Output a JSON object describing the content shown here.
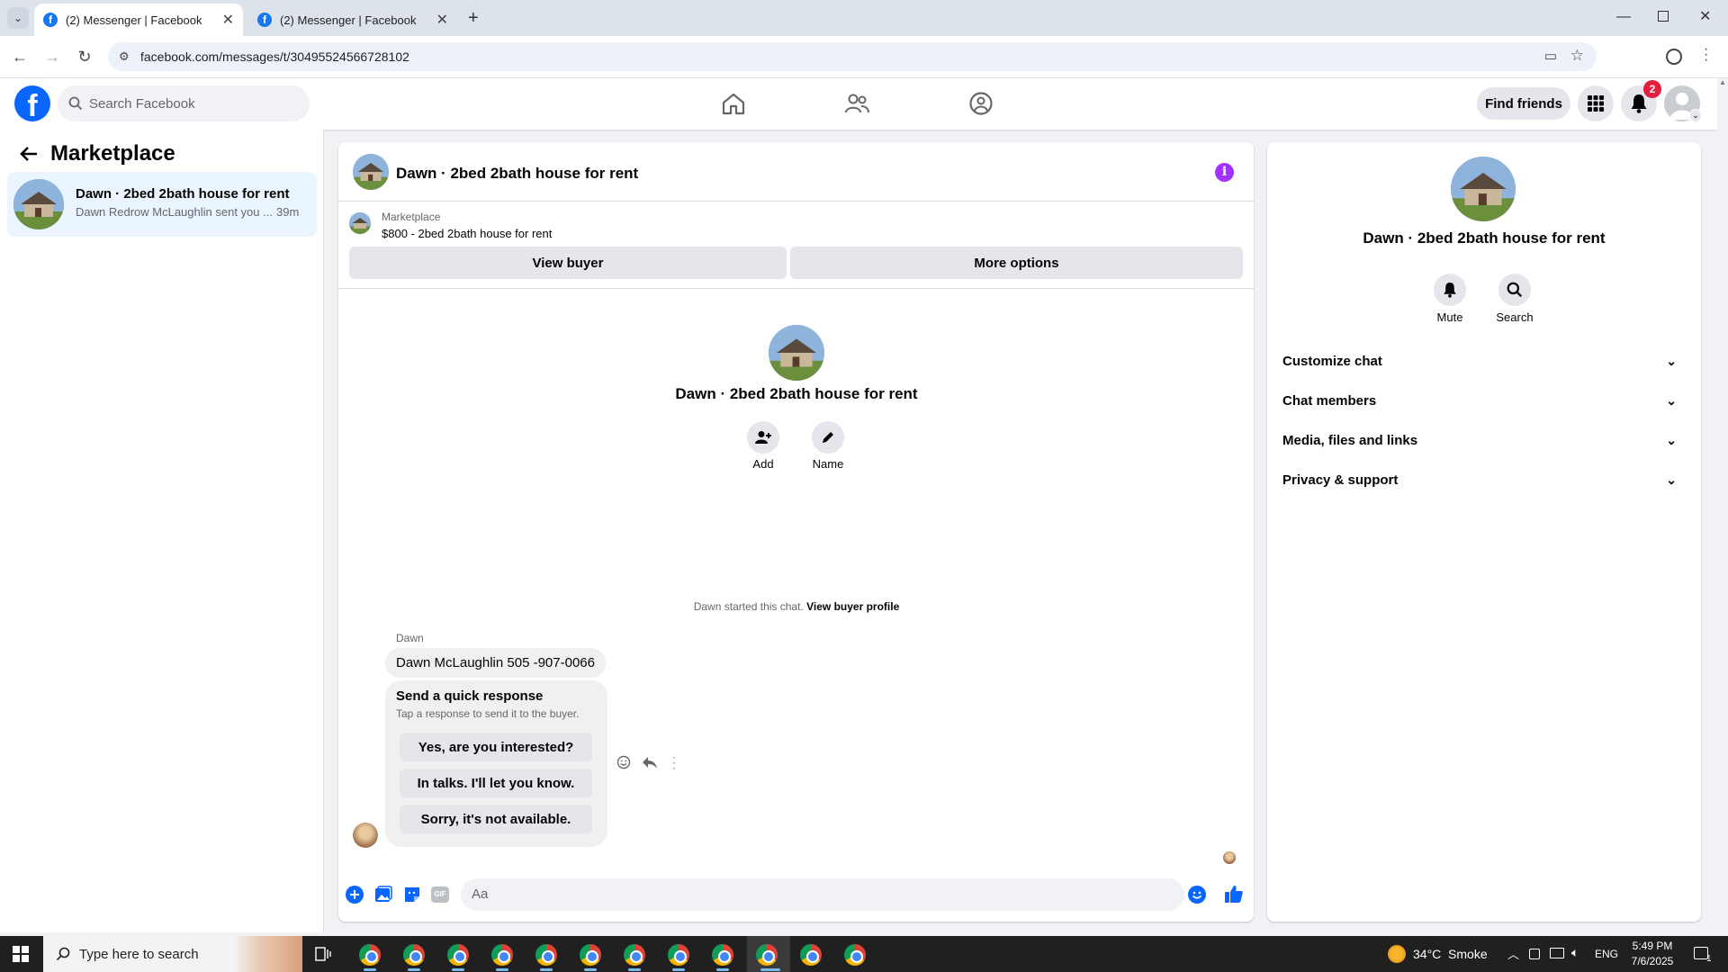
{
  "browser": {
    "tabs": [
      {
        "title": "(2) Messenger | Facebook",
        "active": true
      },
      {
        "title": "(2) Messenger | Facebook",
        "active": false
      }
    ],
    "url": "facebook.com/messages/t/30495524566728102"
  },
  "header": {
    "search_placeholder": "Search Facebook",
    "find_friends": "Find friends",
    "notification_count": "2"
  },
  "sidebar": {
    "title": "Marketplace",
    "conversation": {
      "name": "Dawn · 2bed 2bath house for rent",
      "preview": "Dawn Redrow McLaughlin sent you ...",
      "time": "39m"
    }
  },
  "chat": {
    "title": "Dawn · 2bed 2bath house for rent",
    "listing": {
      "source": "Marketplace",
      "description": "$800 - 2bed 2bath house for rent"
    },
    "view_buyer": "View buyer",
    "more_options": "More options",
    "intro_name": "Dawn · 2bed 2bath house for rent",
    "add_label": "Add",
    "name_label": "Name",
    "started_text": "Dawn started this chat.",
    "view_buyer_profile": "View buyer profile",
    "sender": "Dawn",
    "message": "Dawn McLaughlin 505 -907-0066",
    "quick_title": "Send a quick response",
    "quick_sub": "Tap a response to send it to the buyer.",
    "quick_responses": [
      "Yes, are you interested?",
      "In talks. I'll let you know.",
      "Sorry, it's not available."
    ],
    "composer_placeholder": "Aa"
  },
  "details": {
    "name": "Dawn · 2bed 2bath house for rent",
    "mute": "Mute",
    "search": "Search",
    "sections": [
      "Customize chat",
      "Chat members",
      "Media, files and links",
      "Privacy & support"
    ]
  },
  "taskbar": {
    "search_placeholder": "Type here to search",
    "weather": "34°C  Smoke",
    "lang": "ENG",
    "time": "5:49 PM",
    "date": "7/6/2025",
    "notif_count": "1"
  },
  "colors": {
    "accent": "#0866ff",
    "fb_blue": "#1877f2",
    "info_purple": "#a033ff"
  }
}
